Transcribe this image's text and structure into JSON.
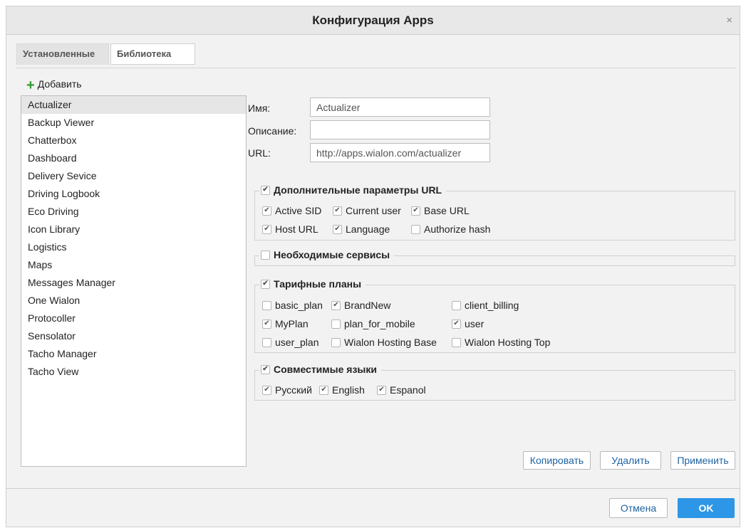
{
  "dialog": {
    "title": "Конфигурация Apps",
    "close_glyph": "×"
  },
  "tabs": [
    {
      "label": "Установленные",
      "active": true
    },
    {
      "label": "Библиотека",
      "active": false
    }
  ],
  "add_label": "Добавить",
  "apps": [
    "Actualizer",
    "Backup Viewer",
    "Chatterbox",
    "Dashboard",
    "Delivery Sevice",
    "Driving Logbook",
    "Eco Driving",
    "Icon Library",
    "Logistics",
    "Maps",
    "Messages Manager",
    "One Wialon",
    "Protocoller",
    "Sensolator",
    "Tacho Manager",
    "Tacho View"
  ],
  "selected_app": "Actualizer",
  "form": {
    "name_label": "Имя:",
    "name_value": "Actualizer",
    "desc_label": "Описание:",
    "desc_value": "",
    "url_label": "URL:",
    "url_value": "http://apps.wialon.com/actualizer"
  },
  "url_params": {
    "legend": "Дополнительные параметры URL",
    "checked": true,
    "options": [
      {
        "label": "Active SID",
        "checked": true
      },
      {
        "label": "Current user",
        "checked": true
      },
      {
        "label": "Base URL",
        "checked": true
      },
      {
        "label": "Host URL",
        "checked": true
      },
      {
        "label": "Language",
        "checked": true
      },
      {
        "label": "Authorize hash",
        "checked": false
      }
    ]
  },
  "services": {
    "legend": "Необходимые сервисы",
    "checked": false
  },
  "plans": {
    "legend": "Тарифные планы",
    "checked": true,
    "options": [
      {
        "label": "basic_plan",
        "checked": false
      },
      {
        "label": "BrandNew",
        "checked": true
      },
      {
        "label": "client_billing",
        "checked": false
      },
      {
        "label": "MyPlan",
        "checked": true
      },
      {
        "label": "plan_for_mobile",
        "checked": false
      },
      {
        "label": "user",
        "checked": true
      },
      {
        "label": "user_plan",
        "checked": false
      },
      {
        "label": "Wialon Hosting Base",
        "checked": false
      },
      {
        "label": "Wialon Hosting Top",
        "checked": false
      }
    ]
  },
  "languages": {
    "legend": "Совместимые языки",
    "checked": true,
    "options": [
      {
        "label": "Русский",
        "checked": true
      },
      {
        "label": "English",
        "checked": true
      },
      {
        "label": "Espanol",
        "checked": true
      }
    ]
  },
  "actions": {
    "copy": "Копировать",
    "delete": "Удалить",
    "apply": "Применить"
  },
  "footer": {
    "cancel": "Отмена",
    "ok": "OK"
  },
  "colors": {
    "ok_button": "#2d96e6",
    "link_text": "#1f63a3",
    "add_icon": "#2e9b2e"
  }
}
